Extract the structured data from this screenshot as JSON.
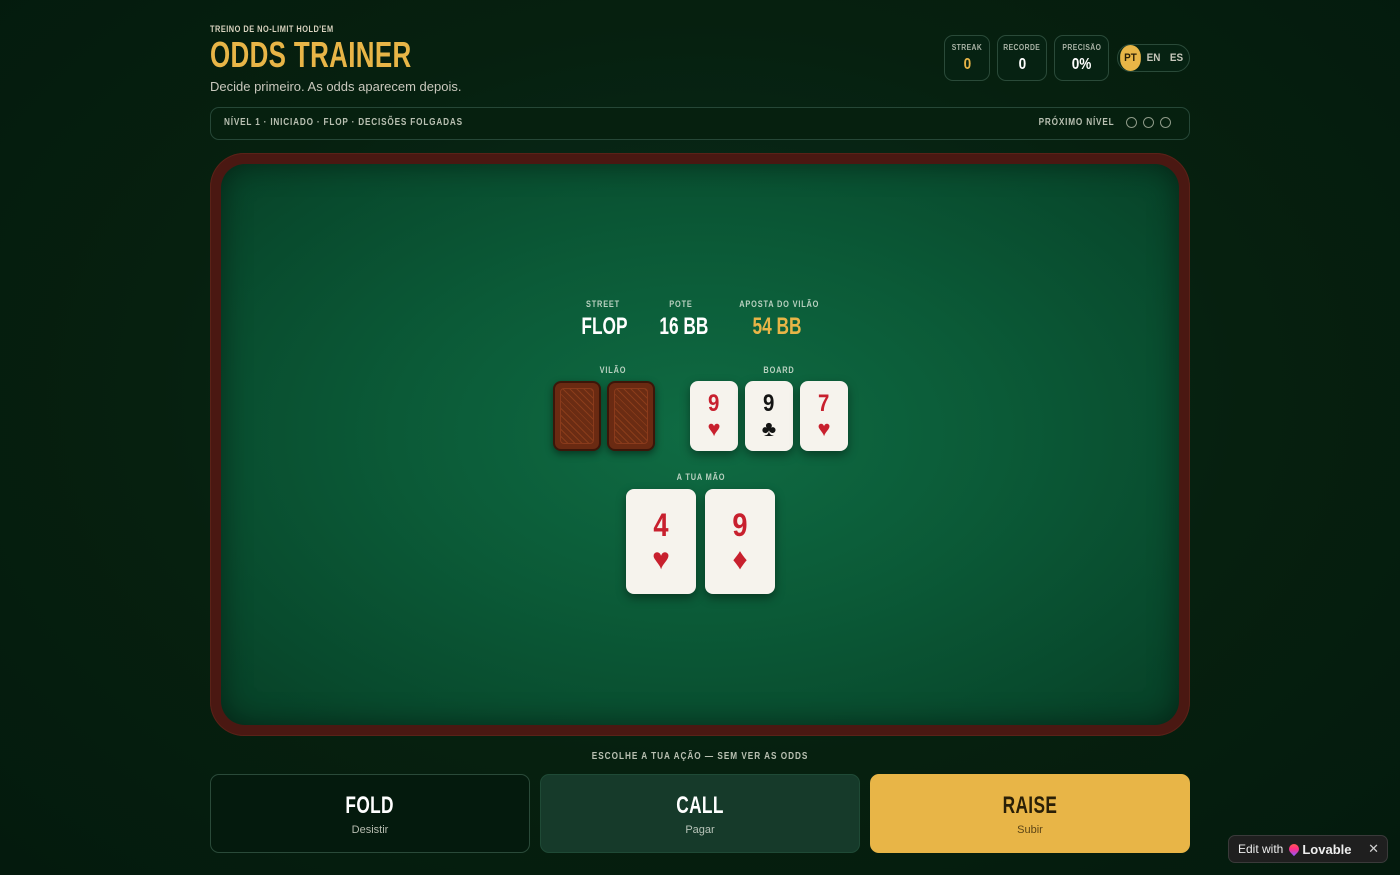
{
  "header": {
    "eyebrow": "TREINO DE NO-LIMIT HOLD'EM",
    "title": "ODDS TRAINER",
    "tagline": "Decide primeiro. As odds aparecem depois."
  },
  "stats": {
    "streak": {
      "label": "STREAK",
      "value": "0"
    },
    "record": {
      "label": "RECORDE",
      "value": "0"
    },
    "accuracy": {
      "label": "PRECISÃO",
      "value": "0%"
    }
  },
  "languages": [
    "PT",
    "EN",
    "ES"
  ],
  "active_language": "PT",
  "level": {
    "text": "NÍVEL 1 · INICIADO · FLOP · DECISÕES FOLGADAS",
    "next_label": "PRÓXIMO NÍVEL",
    "progress_completed": 0,
    "progress_total": 3
  },
  "table": {
    "street": {
      "label": "STREET",
      "value": "FLOP"
    },
    "pot": {
      "label": "POTE",
      "value": "16 BB"
    },
    "villain_bet": {
      "label": "APOSTA DO VILÃO",
      "value": "54 BB"
    },
    "villain_label": "VILÃO",
    "board_label": "BOARD",
    "board": [
      {
        "rank": "9",
        "suit": "♥",
        "color": "red"
      },
      {
        "rank": "9",
        "suit": "♣",
        "color": "black"
      },
      {
        "rank": "7",
        "suit": "♥",
        "color": "red"
      }
    ],
    "hand_label": "A TUA MÃO",
    "hand": [
      {
        "rank": "4",
        "suit": "♥",
        "color": "red"
      },
      {
        "rank": "9",
        "suit": "♦",
        "color": "red"
      }
    ]
  },
  "actions": {
    "hint": "ESCOLHE A TUA AÇÃO — SEM VER AS ODDS",
    "fold": {
      "title": "FOLD",
      "subtitle": "Desistir"
    },
    "call": {
      "title": "CALL",
      "subtitle": "Pagar"
    },
    "raise": {
      "title": "RAISE",
      "subtitle": "Subir"
    }
  },
  "badge": {
    "prefix": "Edit with",
    "brand": "Lovable",
    "close": "✕"
  },
  "colors": {
    "gold": "#e8b547",
    "felt": "#0b5a37",
    "rim": "#4a1812",
    "card_red": "#c8202e"
  }
}
